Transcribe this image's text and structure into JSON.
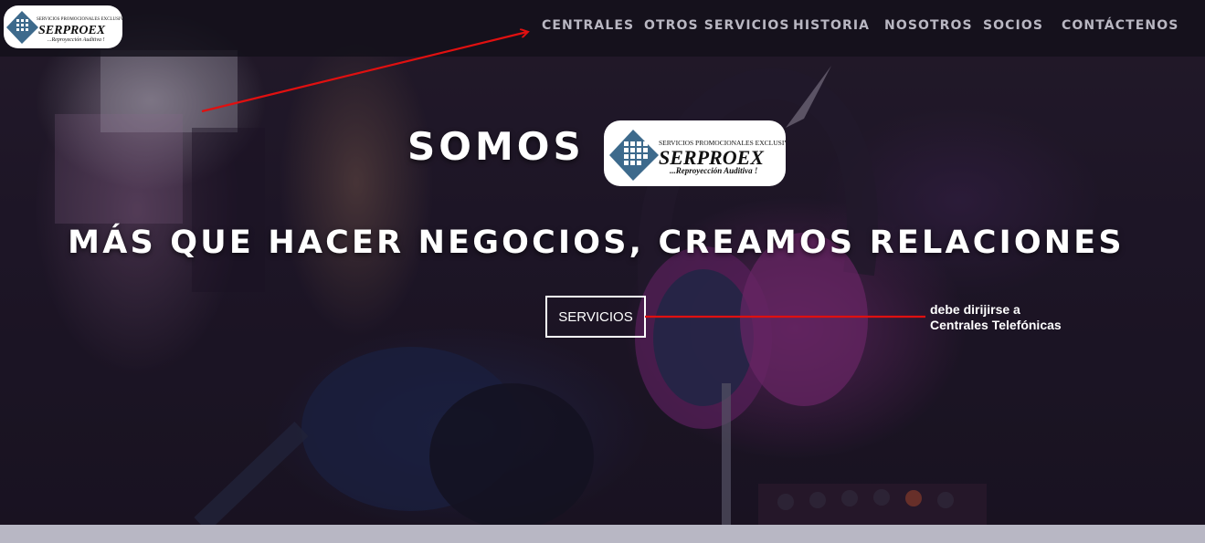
{
  "brand": {
    "name": "SERPROEX",
    "tagline_top": "SERVICIOS PROMOCIONALES EXCLUSIVOS",
    "slogan": "...Reproyección Auditiva !"
  },
  "nav": {
    "items": [
      {
        "label": "CENTRALES"
      },
      {
        "label": "OTROS SERVICIOS"
      },
      {
        "label": "HISTORIA"
      },
      {
        "label": "NOSOTROS"
      },
      {
        "label": "SOCIOS"
      },
      {
        "label": "CONTÁCTENOS"
      }
    ]
  },
  "hero": {
    "somos": "SOMOS",
    "tagline": "MÁS QUE HACER NEGOCIOS, CREAMOS RELACIONES",
    "cta_label": "SERVICIOS"
  },
  "annotation": {
    "line1": "debe dirijirse a",
    "line2": "Centrales Telefónicas",
    "color": "#e01010"
  },
  "colors": {
    "nav_text": "#b9b7c2",
    "hero_text": "#ffffff",
    "logo_blue": "#3d6a8c",
    "bottom_strip": "#b8b7c4"
  }
}
